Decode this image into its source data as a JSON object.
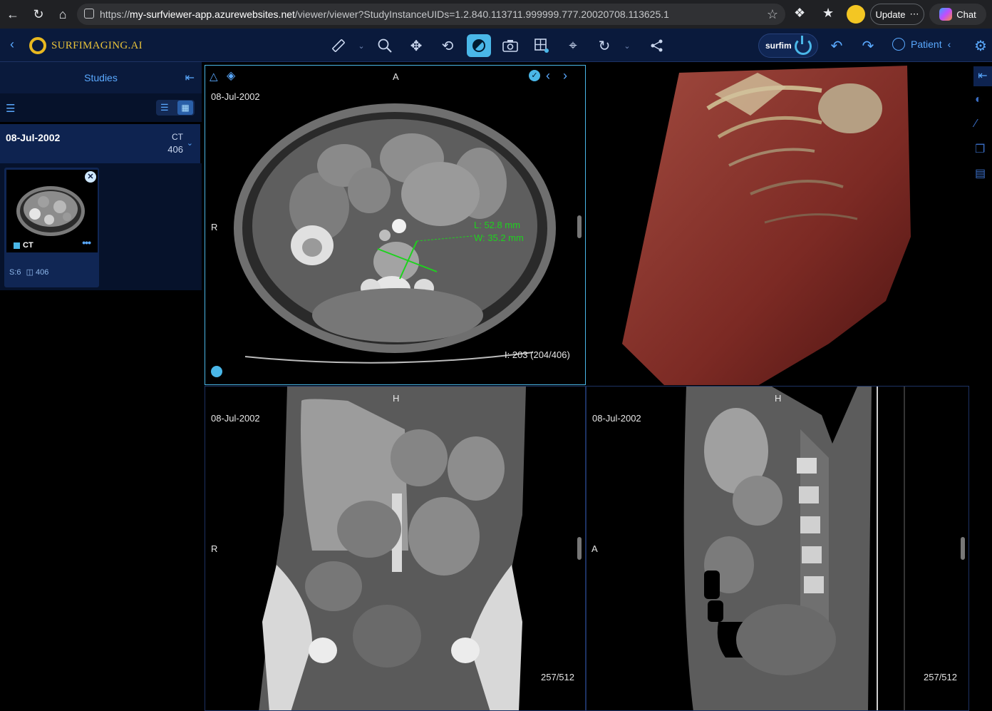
{
  "browser": {
    "url_prefix": "https://",
    "url_domain": "my-surfviewer-app.azurewebsites.net",
    "url_path": "/viewer/viewer?StudyInstanceUIDs=1.2.840.113711.999999.777.20020708.113625.1",
    "update_label": "Update",
    "chat_label": "Chat"
  },
  "header": {
    "logo_text": "SURFIMAGING.AI",
    "surfim_label": "surfim",
    "patient_label": "Patient"
  },
  "sidebar": {
    "title": "Studies",
    "study": {
      "date": "08-Jul-2002",
      "modality": "CT",
      "count": "406"
    },
    "series": {
      "modality": "CT",
      "series_label": "S:6",
      "image_count": "406"
    }
  },
  "viewports": {
    "axial": {
      "orientation_top": "A",
      "orientation_left": "R",
      "date": "08-Jul-2002",
      "slice_info": "I: 203 (204/406)",
      "measure_l": "L: 52.8 mm",
      "measure_w": "W: 35.2 mm"
    },
    "coronal": {
      "orientation_top": "H",
      "orientation_left": "R",
      "date": "08-Jul-2002",
      "slice_info": "257/512"
    },
    "sagittal": {
      "orientation_top": "H",
      "orientation_left": "A",
      "date": "08-Jul-2002",
      "slice_info": "257/512"
    }
  },
  "colors": {
    "accent": "#4ab7e8",
    "header_bg": "#0a1a3c",
    "measure": "#1ed21e",
    "logo": "#e8c23a"
  }
}
